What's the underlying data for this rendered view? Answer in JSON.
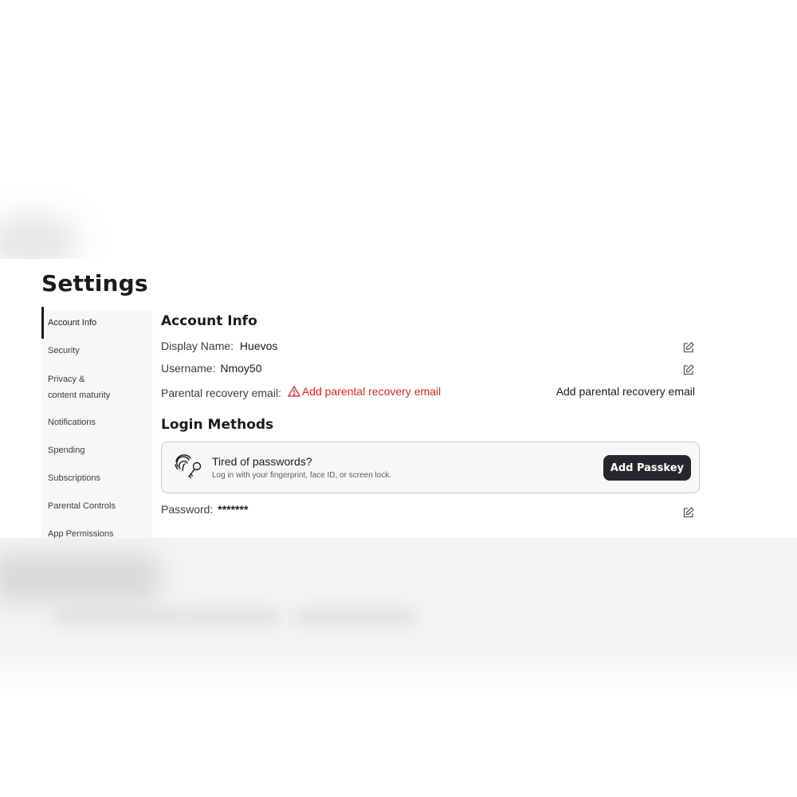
{
  "page": {
    "title": "Settings"
  },
  "sidebar": {
    "items": [
      {
        "label": "Account Info",
        "active": true
      },
      {
        "label": "Security"
      },
      {
        "label": "Privacy & content maturity"
      },
      {
        "label": "Notifications"
      },
      {
        "label": "Spending"
      },
      {
        "label": "Subscriptions"
      },
      {
        "label": "Parental Controls"
      },
      {
        "label": "App Permissions"
      }
    ]
  },
  "account_info": {
    "title": "Account Info",
    "display_name": {
      "label": "Display Name:",
      "value": "Huevos"
    },
    "username": {
      "label": "Username:",
      "value": "Nmoy50"
    },
    "parental_email": {
      "label": "Parental recovery email:",
      "warning": "Add parental recovery email",
      "action": "Add parental recovery email"
    }
  },
  "login_methods": {
    "title": "Login Methods",
    "passkey": {
      "title": "Tired of passwords?",
      "subtitle": "Log in with your fingerprint, face ID, or screen lock.",
      "button": "Add Passkey"
    },
    "password": {
      "label": "Password:",
      "value": "*******"
    }
  },
  "colors": {
    "accent_dark": "#25272b",
    "warning": "#d9262a",
    "sidebar_bg": "#f7f7f8"
  }
}
